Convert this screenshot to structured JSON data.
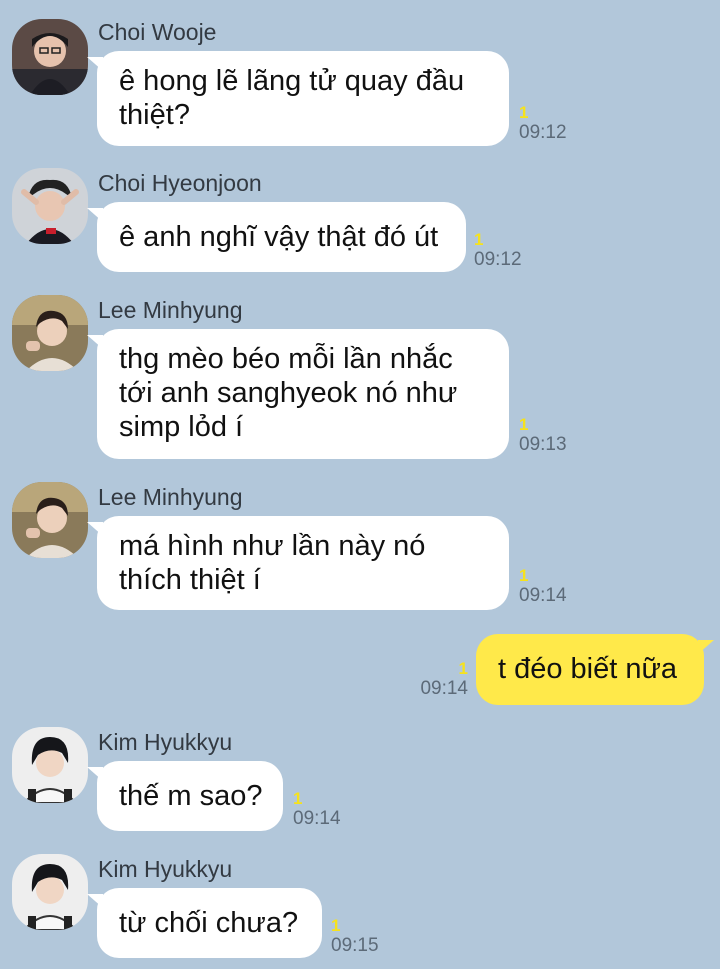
{
  "chat": {
    "messages": [
      {
        "sender": "Choi Wooje",
        "lines": [
          "ê hong lẽ lãng tử quay đầu",
          "thiệt?"
        ],
        "unread": "1",
        "time": "09:12"
      },
      {
        "sender": "Choi Hyeonjoon",
        "lines": [
          "ê anh nghĩ vậy thật đó út"
        ],
        "unread": "1",
        "time": "09:12"
      },
      {
        "sender": "Lee Minhyung",
        "lines": [
          "thg mèo béo mỗi lần nhắc",
          "tới anh sanghyeok nó như",
          "simp lỏd í"
        ],
        "unread": "1",
        "time": "09:13"
      },
      {
        "sender": "Lee Minhyung",
        "lines": [
          "má hình như lần này nó",
          "thích thiệt í"
        ],
        "unread": "1",
        "time": "09:14"
      },
      {
        "sender": "me",
        "lines": [
          "t đéo biết nữa"
        ],
        "unread": "1",
        "time": "09:14"
      },
      {
        "sender": "Kim Hyukkyu",
        "lines": [
          "thế m sao?"
        ],
        "unread": "1",
        "time": "09:14"
      },
      {
        "sender": "Kim Hyukkyu",
        "lines": [
          "từ chối chưa?"
        ],
        "unread": "1",
        "time": "09:15"
      }
    ]
  },
  "colors": {
    "background": "#b2c7da",
    "incoming_bubble": "#ffffff",
    "outgoing_bubble": "#ffe94a",
    "unread_count": "#f6e21c"
  }
}
